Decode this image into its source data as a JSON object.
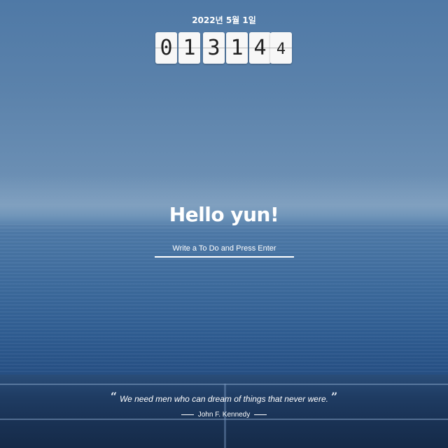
{
  "date_text": "2022년 5월 1일",
  "clock": {
    "digits": [
      "0",
      "1",
      "3",
      "1",
      "4",
      "4"
    ]
  },
  "greeting": "Hello yun!",
  "todo_input": {
    "placeholder": "Write a To Do and Press Enter",
    "value": ""
  },
  "quote": {
    "open_mark": "“",
    "text": "We need men who can dream of things that never were.",
    "close_mark": "”",
    "author": "John F. Kennedy"
  },
  "colors": {
    "text": "#ffffff",
    "clock_tile": "#f7f7f7",
    "clock_digit": "#222222"
  }
}
